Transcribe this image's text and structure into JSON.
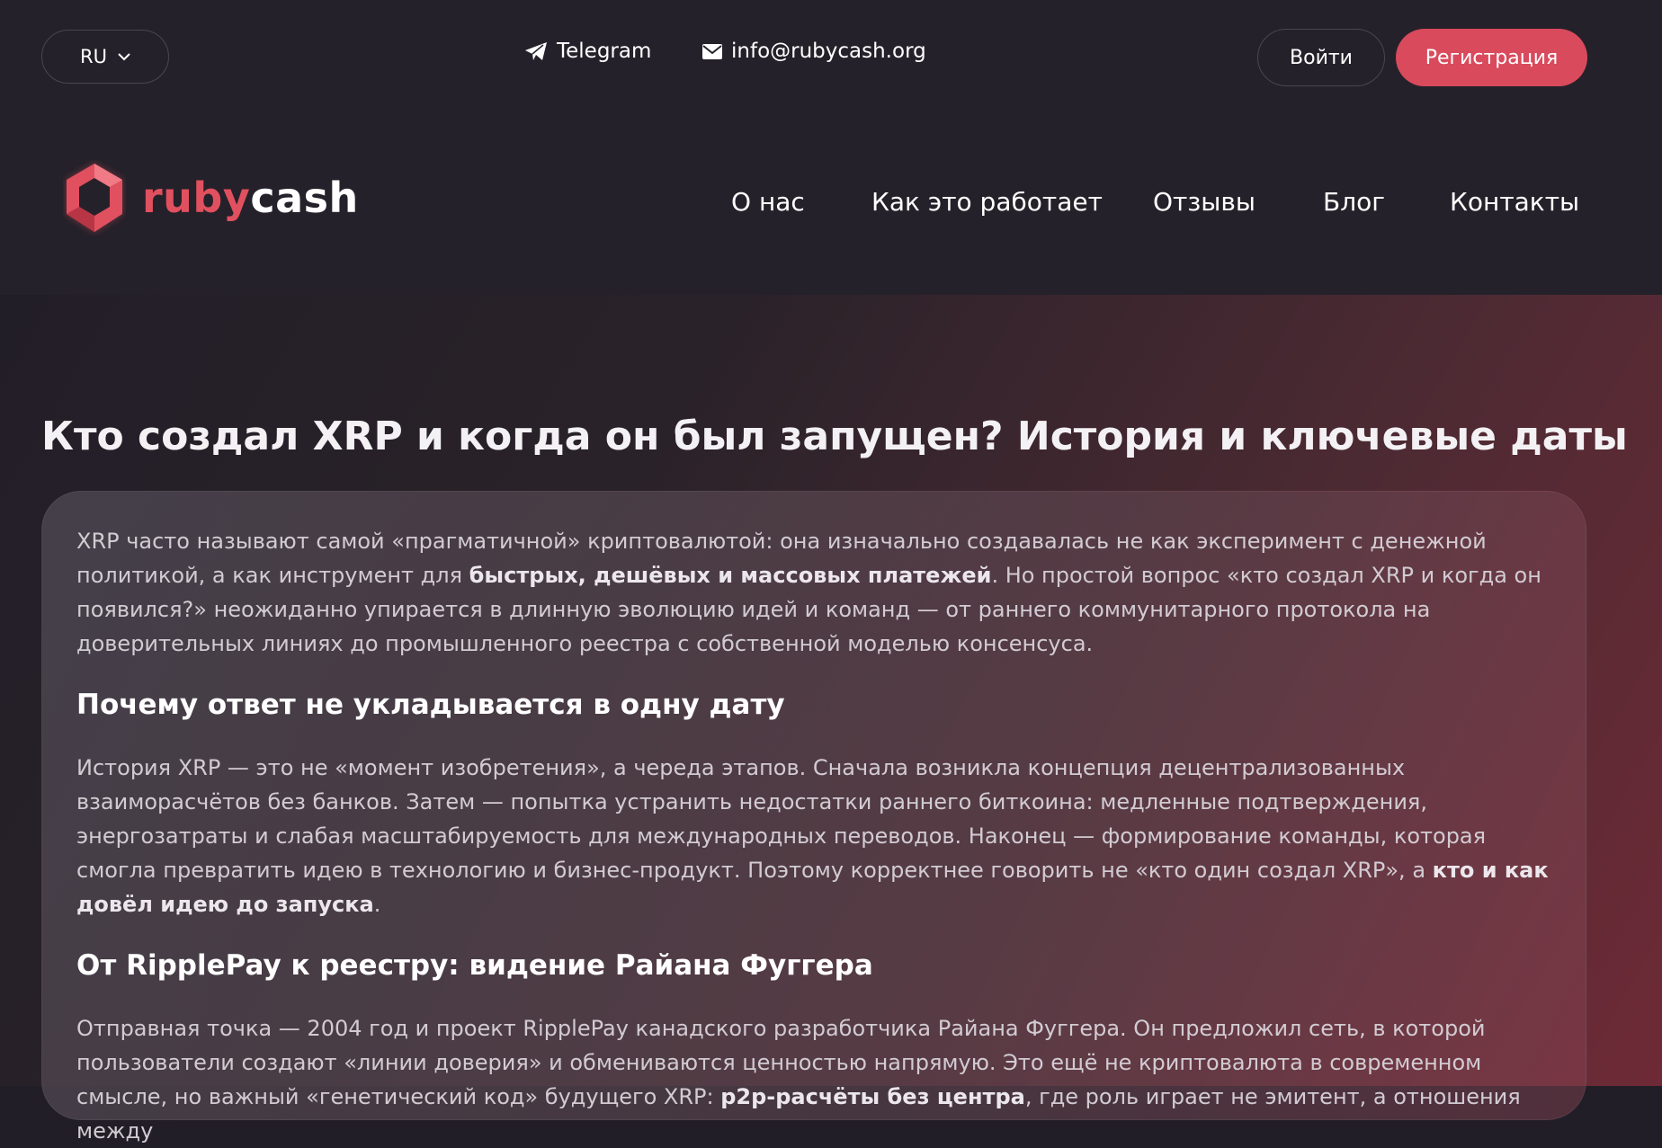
{
  "topbar": {
    "lang": "RU",
    "telegram": "Telegram",
    "email": "info@rubycash.org",
    "login": "Войти",
    "register": "Регистрация"
  },
  "logo": {
    "part1": "ruby",
    "part2": "cash"
  },
  "nav": [
    "О нас",
    "Как это работает",
    "Отзывы",
    "Блог",
    "Контакты"
  ],
  "article": {
    "title": "Кто создал XRP и когда он был запущен? История и ключевые даты",
    "p1_a": "XRP часто называют самой «прагматичной» криптовалютой: она изначально создавалась не как эксперимент с денежной политикой, а как инструмент для ",
    "p1_b": "быстрых, дешёвых и массовых платежей",
    "p1_c": ". Но простой вопрос «кто создал XRP и когда он появился?» неожиданно упирается в длинную эволюцию идей и команд — от раннего коммунитарного протокола на доверительных линиях до промышленного реестра с собственной моделью консенсуса.",
    "h2_1": "Почему ответ не укладывается в одну дату",
    "p2_a": "История XRP — это не «момент изобретения», а череда этапов. Сначала возникла концепция децентрализованных взаиморасчётов без банков. Затем — попытка устранить недостатки раннего биткоина: медленные подтверждения, энергозатраты и слабая масштабируемость для международных переводов. Наконец — формирование команды, которая смогла превратить идею в технологию и бизнес-продукт. Поэтому корректнее говорить не «кто один создал XRP», а ",
    "p2_b": "кто и как довёл идею до запуска",
    "p2_c": ".",
    "h2_2": "От RipplePay к реестру: видение Райана Фуггера",
    "p3_a": "Отправная точка — 2004 год и проект RipplePay канадского разработчика Райана Фуггера. Он предложил сеть, в которой пользователи создают «линии доверия» и обмениваются ценностью напрямую. Это ещё не криптовалюта в современном смысле, но важный «генетический код» будущего XRP: ",
    "p3_b": "p2p-расчёты без центра",
    "p3_c": ", где роль играет не эмитент, а отношения между"
  },
  "colors": {
    "accent": "#d94a5c",
    "background": "#221e27"
  }
}
